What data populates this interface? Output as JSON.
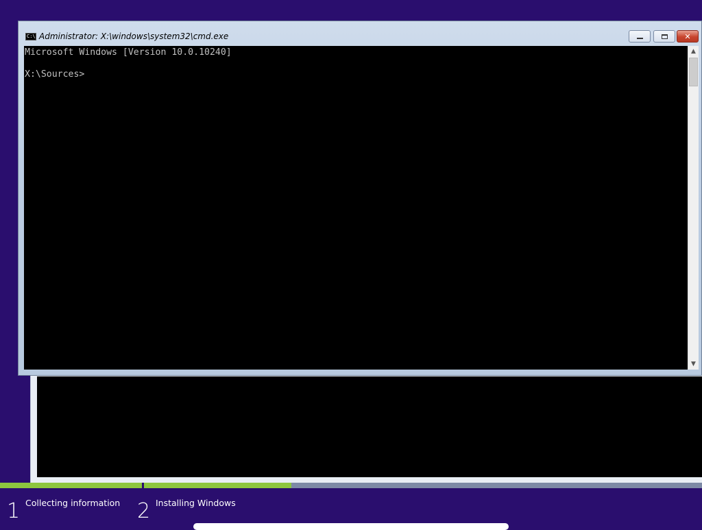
{
  "cmd_window": {
    "title": "Administrator: X:\\windows\\system32\\cmd.exe",
    "console_lines": [
      "Microsoft Windows [Version 10.0.10240]",
      "",
      "X:\\Sources>"
    ]
  },
  "icons": {
    "title": "cmd-icon",
    "minimize": "minimize-icon",
    "maximize": "maximize-icon",
    "close": "close-icon",
    "scroll_up": "chevron-up-icon",
    "scroll_down": "chevron-down-icon"
  },
  "setup_progress": {
    "steps": [
      {
        "number": "1",
        "label": "Collecting information",
        "progress": 1.0
      },
      {
        "number": "2",
        "label": "Installing Windows",
        "progress": 0.26
      }
    ]
  },
  "colors": {
    "desktop": "#2a0e6e",
    "progress_fill": "#8dc63f",
    "progress_track": "#7d8aa6",
    "close_button": "#c8452e"
  }
}
